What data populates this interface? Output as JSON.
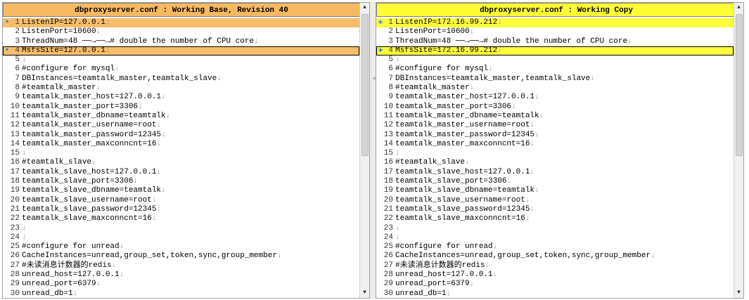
{
  "left": {
    "title": "dbproxyserver.conf : Working Base, Revision 40",
    "lines": [
      {
        "n": "1",
        "text": "ListenIP=127.0.0.1",
        "changed": true,
        "marker": "•"
      },
      {
        "n": "2",
        "text": "ListenPort=10600",
        "changed": false,
        "marker": ""
      },
      {
        "n": "3",
        "text": "ThreadNum=48 ──→──→# double the number of CPU core",
        "changed": false,
        "marker": ""
      },
      {
        "n": "4",
        "text": "MsfsSite=127.0.0.1",
        "changed": true,
        "marker": "•"
      },
      {
        "n": "5",
        "text": "",
        "changed": false,
        "marker": ""
      },
      {
        "n": "6",
        "text": "#configure for mysql",
        "changed": false,
        "marker": ""
      },
      {
        "n": "7",
        "text": "DBInstances=teamtalk_master,teamtalk_slave",
        "changed": false,
        "marker": ""
      },
      {
        "n": "8",
        "text": "#teamtalk_master",
        "changed": false,
        "marker": ""
      },
      {
        "n": "9",
        "text": "teamtalk_master_host=127.0.0.1",
        "changed": false,
        "marker": ""
      },
      {
        "n": "10",
        "text": "teamtalk_master_port=3306",
        "changed": false,
        "marker": ""
      },
      {
        "n": "11",
        "text": "teamtalk_master_dbname=teamtalk",
        "changed": false,
        "marker": ""
      },
      {
        "n": "12",
        "text": "teamtalk_master_username=root",
        "changed": false,
        "marker": ""
      },
      {
        "n": "13",
        "text": "teamtalk_master_password=12345",
        "changed": false,
        "marker": ""
      },
      {
        "n": "14",
        "text": "teamtalk_master_maxconncnt=16",
        "changed": false,
        "marker": ""
      },
      {
        "n": "15",
        "text": "",
        "changed": false,
        "marker": ""
      },
      {
        "n": "16",
        "text": "#teamtalk_slave",
        "changed": false,
        "marker": ""
      },
      {
        "n": "17",
        "text": "teamtalk_slave_host=127.0.0.1",
        "changed": false,
        "marker": ""
      },
      {
        "n": "18",
        "text": "teamtalk_slave_port=3306",
        "changed": false,
        "marker": ""
      },
      {
        "n": "19",
        "text": "teamtalk_slave_dbname=teamtalk",
        "changed": false,
        "marker": ""
      },
      {
        "n": "20",
        "text": "teamtalk_slave_username=root",
        "changed": false,
        "marker": ""
      },
      {
        "n": "21",
        "text": "teamtalk_slave_password=12345",
        "changed": false,
        "marker": ""
      },
      {
        "n": "22",
        "text": "teamtalk_slave_maxconncnt=16",
        "changed": false,
        "marker": ""
      },
      {
        "n": "23",
        "text": "",
        "changed": false,
        "marker": ""
      },
      {
        "n": "24",
        "text": "",
        "changed": false,
        "marker": ""
      },
      {
        "n": "25",
        "text": "#configure for unread",
        "changed": false,
        "marker": ""
      },
      {
        "n": "26",
        "text": "CacheInstances=unread,group_set,token,sync,group_member",
        "changed": false,
        "marker": ""
      },
      {
        "n": "27",
        "text": "#未读消息计数器的redis",
        "changed": false,
        "marker": ""
      },
      {
        "n": "28",
        "text": "unread_host=127.0.0.1",
        "changed": false,
        "marker": ""
      },
      {
        "n": "29",
        "text": "unread_port=6379",
        "changed": false,
        "marker": ""
      },
      {
        "n": "30",
        "text": "unread_db=1",
        "changed": false,
        "marker": ""
      }
    ]
  },
  "right": {
    "title": "dbproxyserver.conf : Working Copy",
    "lines": [
      {
        "n": "1",
        "text": "ListenIP=172.16.99.212",
        "changed": true,
        "marker": "✚"
      },
      {
        "n": "2",
        "text": "ListenPort=10600",
        "changed": false,
        "marker": ""
      },
      {
        "n": "3",
        "text": "ThreadNum=48 ──→──→# double the number of CPU core",
        "changed": false,
        "marker": ""
      },
      {
        "n": "4",
        "text": "MsfsSite=172.16.99.212",
        "changed": true,
        "marker": "✚"
      },
      {
        "n": "5",
        "text": "",
        "changed": false,
        "marker": ""
      },
      {
        "n": "6",
        "text": "#configure for mysql",
        "changed": false,
        "marker": ""
      },
      {
        "n": "7",
        "text": "DBInstances=teamtalk_master,teamtalk_slave",
        "changed": false,
        "marker": ""
      },
      {
        "n": "8",
        "text": "#teamtalk_master",
        "changed": false,
        "marker": ""
      },
      {
        "n": "9",
        "text": "teamtalk_master_host=127.0.0.1",
        "changed": false,
        "marker": ""
      },
      {
        "n": "10",
        "text": "teamtalk_master_port=3306",
        "changed": false,
        "marker": ""
      },
      {
        "n": "11",
        "text": "teamtalk_master_dbname=teamtalk",
        "changed": false,
        "marker": ""
      },
      {
        "n": "12",
        "text": "teamtalk_master_username=root",
        "changed": false,
        "marker": ""
      },
      {
        "n": "13",
        "text": "teamtalk_master_password=12345",
        "changed": false,
        "marker": ""
      },
      {
        "n": "14",
        "text": "teamtalk_master_maxconncnt=16",
        "changed": false,
        "marker": ""
      },
      {
        "n": "15",
        "text": "",
        "changed": false,
        "marker": ""
      },
      {
        "n": "16",
        "text": "#teamtalk_slave",
        "changed": false,
        "marker": ""
      },
      {
        "n": "17",
        "text": "teamtalk_slave_host=127.0.0.1",
        "changed": false,
        "marker": ""
      },
      {
        "n": "18",
        "text": "teamtalk_slave_port=3306",
        "changed": false,
        "marker": ""
      },
      {
        "n": "19",
        "text": "teamtalk_slave_dbname=teamtalk",
        "changed": false,
        "marker": ""
      },
      {
        "n": "20",
        "text": "teamtalk_slave_username=root",
        "changed": false,
        "marker": ""
      },
      {
        "n": "21",
        "text": "teamtalk_slave_password=12345",
        "changed": false,
        "marker": ""
      },
      {
        "n": "22",
        "text": "teamtalk_slave_maxconncnt=16",
        "changed": false,
        "marker": ""
      },
      {
        "n": "23",
        "text": "",
        "changed": false,
        "marker": ""
      },
      {
        "n": "24",
        "text": "",
        "changed": false,
        "marker": ""
      },
      {
        "n": "25",
        "text": "#configure for unread",
        "changed": false,
        "marker": ""
      },
      {
        "n": "26",
        "text": "CacheInstances=unread,group_set,token,sync,group_member",
        "changed": false,
        "marker": ""
      },
      {
        "n": "27",
        "text": "#未读消息计数器的redis",
        "changed": false,
        "marker": ""
      },
      {
        "n": "28",
        "text": "unread_host=127.0.0.1",
        "changed": false,
        "marker": ""
      },
      {
        "n": "29",
        "text": "unread_port=6379",
        "changed": false,
        "marker": ""
      },
      {
        "n": "30",
        "text": "unread_db=1",
        "changed": false,
        "marker": ""
      }
    ]
  },
  "colors": {
    "base_changed": "#f7bd6a",
    "working_changed": "#ffff3c",
    "marker_blue": "#3a7fd0"
  },
  "icons": {
    "eol": "end-of-line-icon",
    "added_marker": "plus-marker-icon",
    "changed_marker": "dot-marker-icon"
  }
}
